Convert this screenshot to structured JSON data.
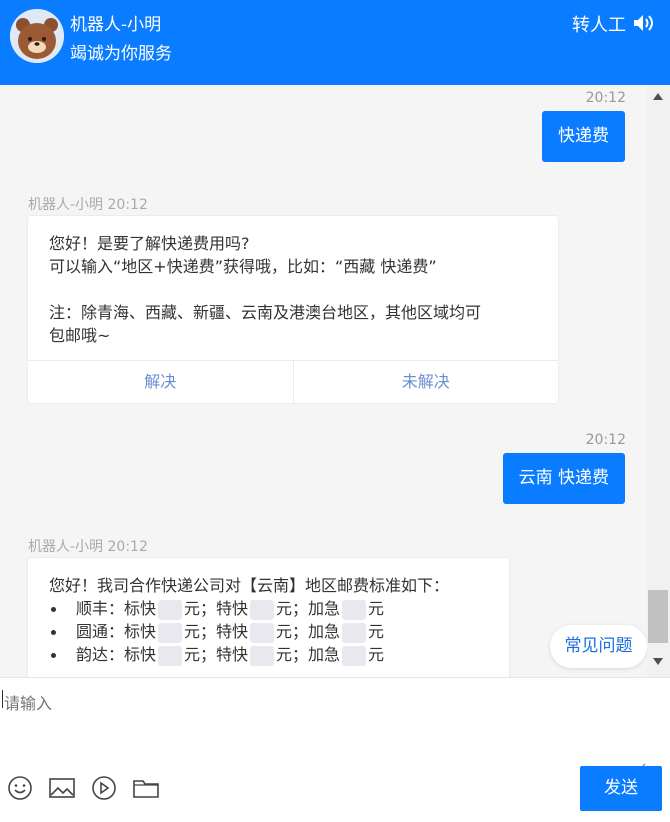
{
  "header": {
    "title": "机器人-小明",
    "subtitle": "竭诚为你服务",
    "transfer_label": "转人工",
    "speaker_icon": "speaker-icon",
    "avatar_icon": "bear-avatar"
  },
  "messages": {
    "m1": {
      "time": "20:12",
      "text": "快递费"
    },
    "m2": {
      "meta": "机器人-小明 20:12",
      "line1": "您好！是要了解快递费用吗?",
      "line2": "可以输入“地区+快递费”获得哦，比如：“西藏 快递费”",
      "line3": "注：除青海、西藏、新疆、云南及港澳台地区，其他区域均可",
      "line4": "包邮哦~",
      "resolved": "解决",
      "unresolved": "未解决"
    },
    "m3": {
      "time": "20:12",
      "text": "云南 快递费"
    },
    "m4": {
      "meta": "机器人-小明 20:12",
      "intro": "您好！我司合作快递公司对【云南】地区邮费标准如下：",
      "items": [
        {
          "carrier": "顺丰：标快",
          "unit1": "元；特快",
          "unit2": "元；加急",
          "unit3": "元"
        },
        {
          "carrier": "圆通：标快",
          "unit1": "元；特快",
          "unit2": "元；加急",
          "unit3": "元"
        },
        {
          "carrier": "韵达：标快",
          "unit1": "元；特快",
          "unit2": "元；加急",
          "unit3": "元"
        }
      ]
    }
  },
  "faq_label": "常见问题",
  "input": {
    "placeholder": "请输入"
  },
  "send_label": "发送",
  "colors": {
    "brand": "#0a7cff",
    "faq_text": "#1a6fe0",
    "action_text": "#6a8fd0"
  }
}
